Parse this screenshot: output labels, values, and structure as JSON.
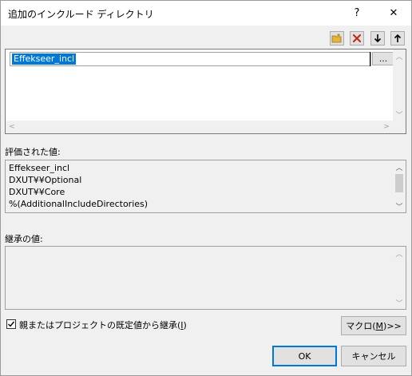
{
  "window": {
    "title": "追加のインクルード ディレクトリ",
    "help_glyph": "?",
    "close_glyph": "✕"
  },
  "toolbar": {
    "new_line_icon": "new-line-icon",
    "delete_icon": "delete-icon",
    "move_down_icon": "move-down-icon",
    "move_up_icon": "move-up-icon"
  },
  "editor": {
    "current_value": "Effekseer_incl",
    "browse_label": "..."
  },
  "evaluated": {
    "label": "評価された値:",
    "lines": [
      "Effekseer_incl",
      "DXUT¥¥Optional",
      "DXUT¥¥Core",
      "%(AdditionalIncludeDirectories)"
    ]
  },
  "inherited": {
    "label": "継承の値:"
  },
  "inherit_checkbox": {
    "label_prefix": "親またはプロジェクトの既定値から継承(",
    "label_accel": "I",
    "label_suffix": ")",
    "checked": true
  },
  "buttons": {
    "macro_prefix": "マクロ(",
    "macro_accel": "M",
    "macro_suffix": ")>>",
    "ok": "OK",
    "cancel": "キャンセル"
  },
  "colors": {
    "selection": "#0078d7",
    "delete_red": "#c42b1c",
    "folder_yellow": "#e8b339"
  }
}
